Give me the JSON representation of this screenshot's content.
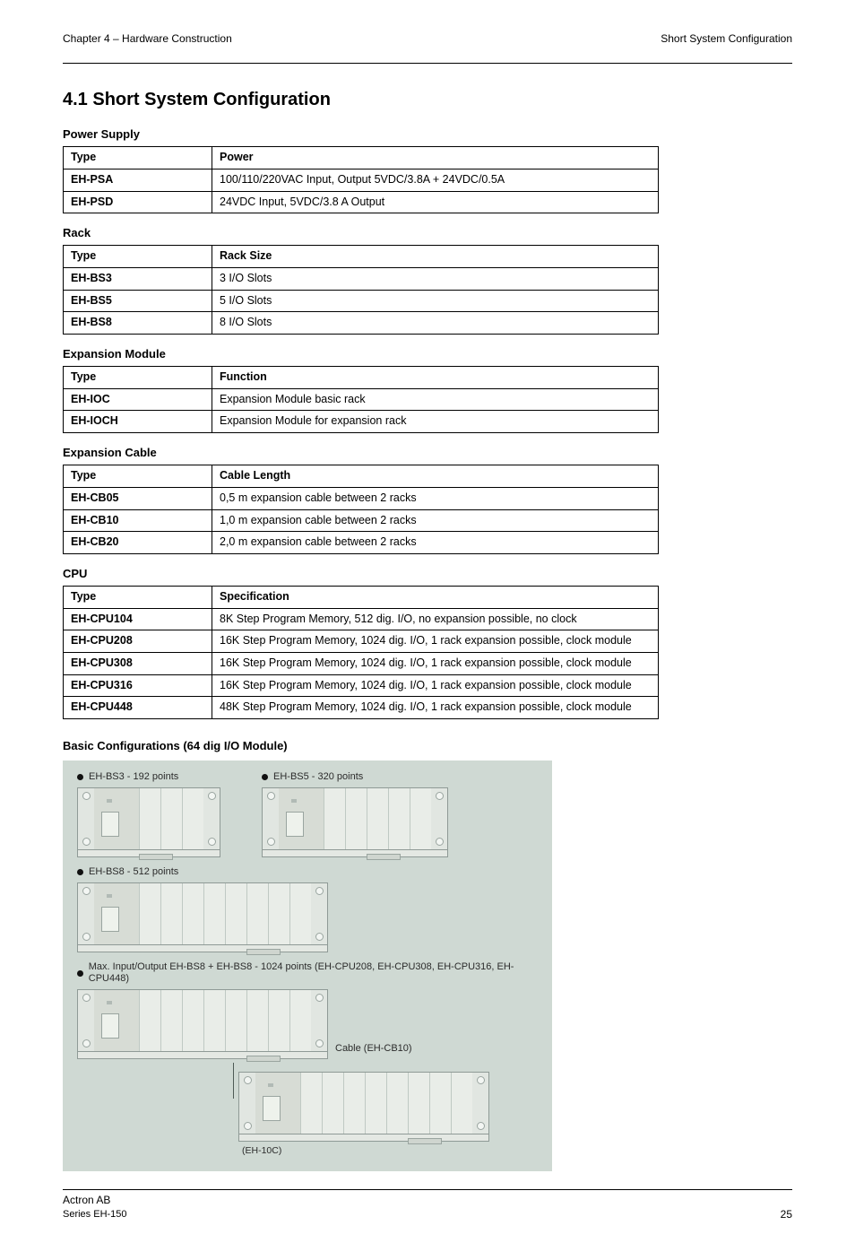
{
  "header": {
    "chapter_left": "Chapter 4 – Hardware Construction",
    "chapter_right": "Short System Configuration"
  },
  "title": "4.1 Short System Configuration",
  "sections": {
    "power": {
      "label": "Power Supply",
      "cols": [
        "Type",
        "Power"
      ],
      "rows": [
        [
          "EH-PSA",
          "100/110/220VAC Input, Output 5VDC/3.8A + 24VDC/0.5A"
        ],
        [
          "EH-PSD",
          "24VDC Input, 5VDC/3.8 A Output"
        ]
      ]
    },
    "rack": {
      "label": "Rack",
      "cols": [
        "Type",
        "Rack Size"
      ],
      "rows": [
        [
          "EH-BS3",
          "3 I/O Slots"
        ],
        [
          "EH-BS5",
          "5 I/O Slots"
        ],
        [
          "EH-BS8",
          "8 I/O Slots"
        ]
      ]
    },
    "expansion": {
      "label": "Expansion Module",
      "cols": [
        "Type",
        "Function"
      ],
      "rows": [
        [
          "EH-IOC",
          "Expansion Module basic rack"
        ],
        [
          "EH-IOCH",
          "Expansion Module for expansion rack"
        ]
      ]
    },
    "cable": {
      "label": "Expansion Cable",
      "cols": [
        "Type",
        "Cable Length"
      ],
      "rows": [
        [
          "EH-CB05",
          "0,5 m expansion cable between 2 racks"
        ],
        [
          "EH-CB10",
          "1,0 m expansion cable between 2 racks"
        ],
        [
          "EH-CB20",
          "2,0 m expansion cable between 2 racks"
        ]
      ]
    },
    "cpu": {
      "label": "CPU",
      "cols": [
        "Type",
        "Specification"
      ],
      "rows": [
        [
          "EH-CPU104",
          "8K Step Program Memory, 512 dig. I/O, no expansion possible, no clock"
        ],
        [
          "EH-CPU208",
          "16K Step Program Memory, 1024 dig. I/O, 1 rack expansion possible, clock module"
        ],
        [
          "EH-CPU308",
          "16K Step Program Memory, 1024 dig. I/O, 1 rack expansion possible, clock module"
        ],
        [
          "EH-CPU316",
          "16K Step Program Memory, 1024 dig. I/O, 1 rack expansion possible, clock module"
        ],
        [
          "EH-CPU448",
          "48K Step Program Memory, 1024 dig. I/O, 1 rack expansion possible, clock module"
        ]
      ]
    }
  },
  "figure": {
    "caption": "Basic Configurations (64 dig I/O Module)",
    "blocks": {
      "bs3": "EH-BS3 - 192 points",
      "bs5": "EH-BS5 - 320 points",
      "bs8": "EH-BS8 - 512 points",
      "max": "Max. Input/Output EH-BS8 + EH-BS8 - 1024 points (EH-CPU208, EH-CPU308, EH-CPU316, EH-CPU448)",
      "cable": "Cable (EH-CB10)",
      "ioc": "(EH-10C)"
    }
  },
  "footer": {
    "company": "Actron AB",
    "series": "Series EH-150",
    "page": "25"
  }
}
